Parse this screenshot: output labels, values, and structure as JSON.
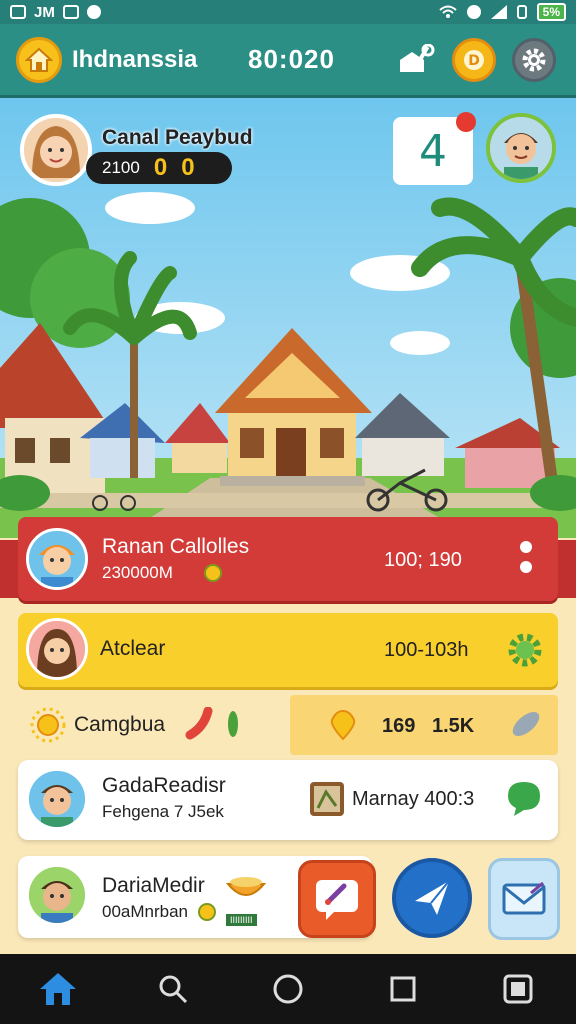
{
  "status_bar": {
    "left_text": "JM",
    "battery": "5%"
  },
  "header": {
    "region": "Ihdnanssia",
    "timer": "80:020"
  },
  "player": {
    "name": "Canal Peaybud",
    "score": "2100",
    "counter_a": "0",
    "counter_b": "0"
  },
  "level": {
    "number": "4"
  },
  "rows": [
    {
      "title": "Ranan Callolles",
      "sub": "230000M",
      "value": "100; 190"
    },
    {
      "title": "Atclear",
      "value": "100-103h"
    },
    {
      "title": "Camgbua",
      "value_a": "169",
      "value_b": "1.5K"
    },
    {
      "title": "GadaReadisr",
      "sub": "Fehgena 7 J5ek",
      "value": "Marnay 400:3"
    },
    {
      "title": "DariaMedir",
      "sub": "00aMnrban",
      "tag": "IIIIIIIII"
    }
  ],
  "colors": {
    "header_teal": "#2c8f86",
    "row_red": "#d23b38",
    "row_yellow": "#f9cf2c",
    "page_bg": "#fbe8b8"
  }
}
